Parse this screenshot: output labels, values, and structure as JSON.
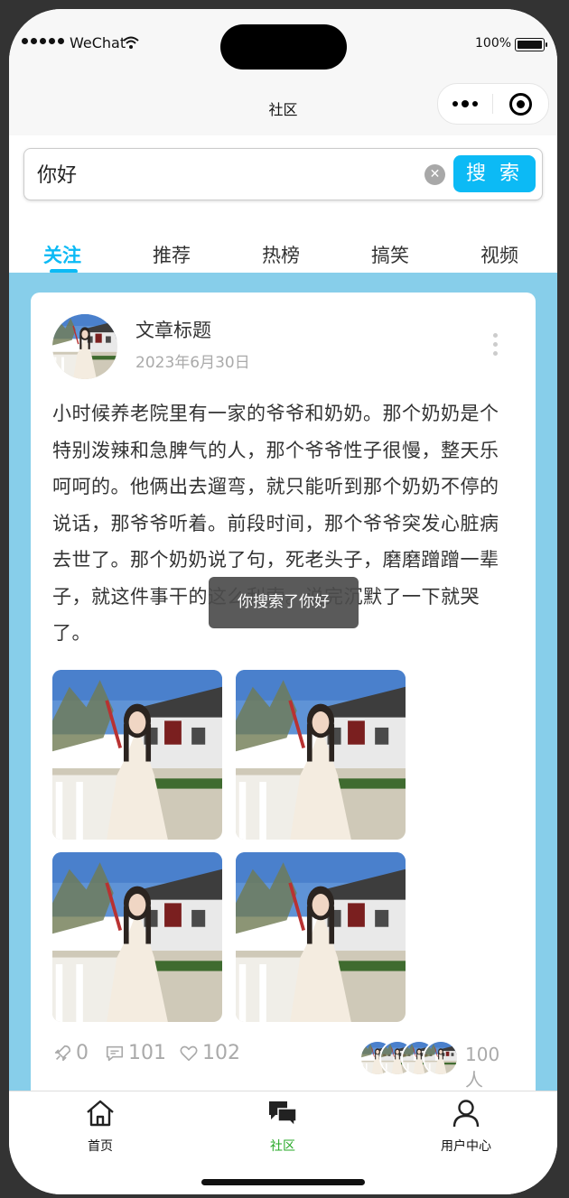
{
  "status_bar": {
    "carrier": "WeChat",
    "battery": "100%"
  },
  "nav": {
    "title": "社区"
  },
  "search": {
    "value": "你好",
    "button_label": "搜 索"
  },
  "tabs": [
    {
      "label": "关注",
      "active": true
    },
    {
      "label": "推荐"
    },
    {
      "label": "热榜"
    },
    {
      "label": "搞笑"
    },
    {
      "label": "视频"
    }
  ],
  "post": {
    "title": "文章标题",
    "date": "2023年6月30日",
    "body": "小时候养老院里有一家的爷爷和奶奶。那个奶奶是个特别泼辣和急脾气的人，那个爷爷性子很慢，整天乐呵呵的。他俩出去遛弯，就只能听到那个奶奶不停的说话，那爷爷听着。前段时间，那个爷爷突发心脏病去世了。那个奶奶说了句，死老头子，磨磨蹭蹭一辈子，就这件事干的这么利索。说完沉默了一下就哭了。",
    "stats": {
      "shares": "0",
      "comments": "101",
      "likes": "102",
      "people": "100人"
    }
  },
  "toast": {
    "text": "你搜索了你好"
  },
  "tabbar": [
    {
      "label": "首页",
      "icon": "home-icon"
    },
    {
      "label": "社区",
      "icon": "chat-bubbles-icon",
      "active": true
    },
    {
      "label": "用户中心",
      "icon": "user-icon"
    }
  ],
  "colors": {
    "accent": "#0cbaf5",
    "content_bg": "#87ceea",
    "tab_active": "#26a826"
  }
}
